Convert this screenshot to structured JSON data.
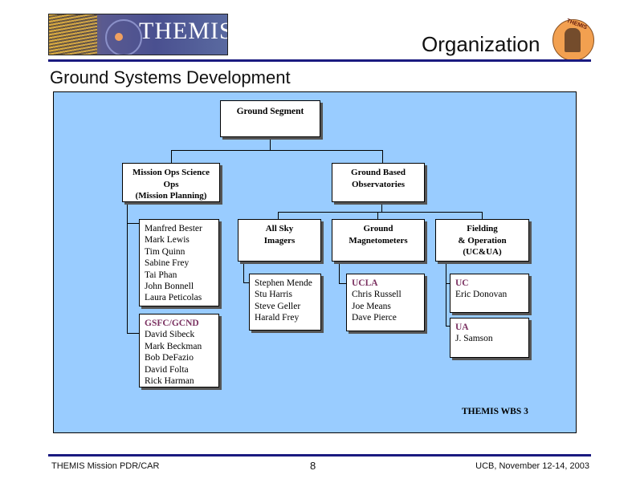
{
  "header": {
    "logo_text": "THEMIS",
    "section_title": "Organization",
    "badge_text": "THEMIS",
    "slide_title": "Ground Systems Development"
  },
  "colors": {
    "panel_background": "#99ccff",
    "header_rule": "#1a1a80",
    "org_label": "#7a3060"
  },
  "chart": {
    "root": {
      "label": "Ground Segment"
    },
    "mission_ops": {
      "label_line1": "Mission Ops  Science",
      "label_line2": "Ops",
      "label_line3": "(Mission Planning)",
      "team1": [
        "Manfred Bester",
        "Mark Lewis",
        "Tim Quinn",
        "Sabine Frey",
        "Tai Phan",
        "John Bonnell",
        "Laura Peticolas"
      ],
      "team2": {
        "org": "GSFC/GCND",
        "members": [
          "David Sibeck",
          "Mark Beckman",
          "Bob DeFazio",
          "David Folta",
          "Rick Harman"
        ]
      }
    },
    "ground_based": {
      "label_line1": "Ground Based",
      "label_line2": "Observatories",
      "all_sky": {
        "label_line1": "All Sky",
        "label_line2": "Imagers",
        "members": [
          "Stephen Mende",
          "Stu Harris",
          "Steve Geller",
          "Harald Frey"
        ]
      },
      "magnetometers": {
        "label_line1": "Ground",
        "label_line2": "Magnetometers",
        "org": "UCLA",
        "members": [
          "Chris Russell",
          "Joe Means",
          "Dave Pierce"
        ]
      },
      "fielding": {
        "label_line1": "Fielding",
        "label_line2": "& Operation",
        "label_line3": "(UC&UA)",
        "uc": {
          "org": "UC",
          "members": [
            "Eric Donovan"
          ]
        },
        "ua": {
          "org": "UA",
          "members": [
            "J. Samson"
          ]
        }
      }
    },
    "wbs_label": "THEMIS WBS 3"
  },
  "footer": {
    "left": "THEMIS Mission PDR/CAR",
    "page_number": "8",
    "right": "UCB, November 12-14, 2003"
  }
}
